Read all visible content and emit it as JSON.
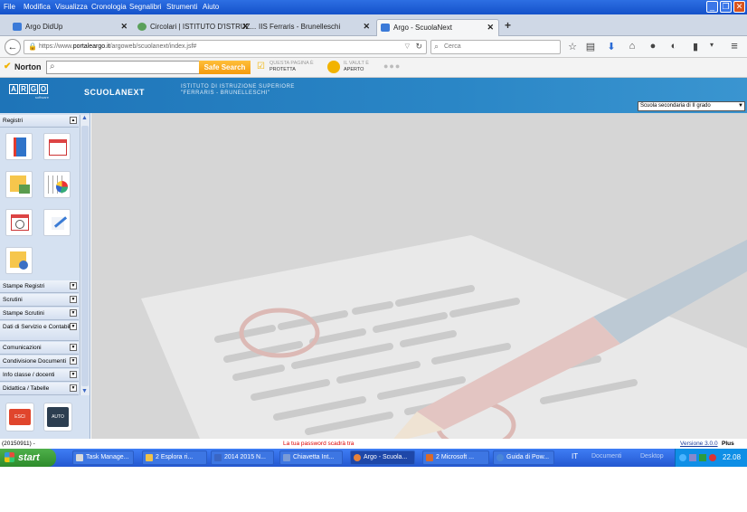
{
  "menubar": {
    "items": [
      "File",
      "Modifica",
      "Visualizza",
      "Cronologia",
      "Segnalibri",
      "Strumenti",
      "Aiuto"
    ]
  },
  "window_controls": {
    "minimize": "_",
    "maximize": "❐",
    "close": "✕"
  },
  "tabs": [
    {
      "label": "Argo DidUp",
      "color": "#3b7ad8"
    },
    {
      "label": "Circolari | ISTITUTO D'ISTRUZ...",
      "color": "#5aa05a"
    },
    {
      "label": "IIS Ferraris - Brunelleschi",
      "color": "#cccccc"
    },
    {
      "label": "Argo - ScuolaNext",
      "color": "#3b7ad8"
    }
  ],
  "new_tab": "+",
  "navbar": {
    "url_prefix": "https://www.",
    "url_domain": "portaleargo.it",
    "url_path": "/argoweb/scuolanext/index.jsf#",
    "search_placeholder": "Cerca"
  },
  "norton": {
    "brand": "Norton",
    "safe_search": "Safe Search",
    "page_status_line1": "QUESTA PAGINA È",
    "page_status_line2": "PROTETTA",
    "vault_line1": "IL VAULT È",
    "vault_line2": "APERTO"
  },
  "header": {
    "logo_letters": [
      "A",
      "R",
      "G",
      "O"
    ],
    "logo_sub": "software",
    "app_name": "SCUOLANEXT",
    "school_line1": "ISTITUTO DI ISTRUZIONE SUPERIORE",
    "school_line2": "\"FERRARIS - BRUNELLESCHI\"",
    "school_select": "Scuola secondaria di II grado"
  },
  "sidebar": {
    "registri_title": "Registri",
    "sections": [
      "Stampe Registri",
      "Scrutini",
      "Stampe Scrutini",
      "Dati di Servizio e Contabili",
      "Comunicazioni",
      "Condivisione Documenti",
      "Info classe / docenti",
      "Didattica / Tabelle"
    ],
    "bottom_buttons": [
      "ESCI",
      "AUTO"
    ]
  },
  "statusbar": {
    "left": "(20150911) -",
    "center": "La tua password scadrà tra",
    "version": "Versione 3.0.0",
    "plus": "Plus"
  },
  "taskbar": {
    "start": "start",
    "items": [
      {
        "label": "Task Manage...",
        "color": "#d9d9d9"
      },
      {
        "label": "2 Esplora ri...",
        "color": "#f0c24a"
      },
      {
        "label": "2014 2015 N...",
        "color": "#3a66c4"
      },
      {
        "label": "Chiavetta Int...",
        "color": "#7a9bd6"
      },
      {
        "label": "Argo - Scuola...",
        "color": "#e8823a"
      },
      {
        "label": "2 Microsoft ...",
        "color": "#d96a2c"
      },
      {
        "label": "Guida di Pow...",
        "color": "#4a86d8"
      }
    ],
    "lang": "IT",
    "toolbars": [
      "Documenti",
      "Desktop"
    ],
    "clock": "22.08"
  },
  "colors": {
    "header_blue": "#1e74b8",
    "sidebar_bg": "#d5e1f1",
    "norton_orange": "#f39a0c",
    "xp_blue": "#2457d0"
  }
}
